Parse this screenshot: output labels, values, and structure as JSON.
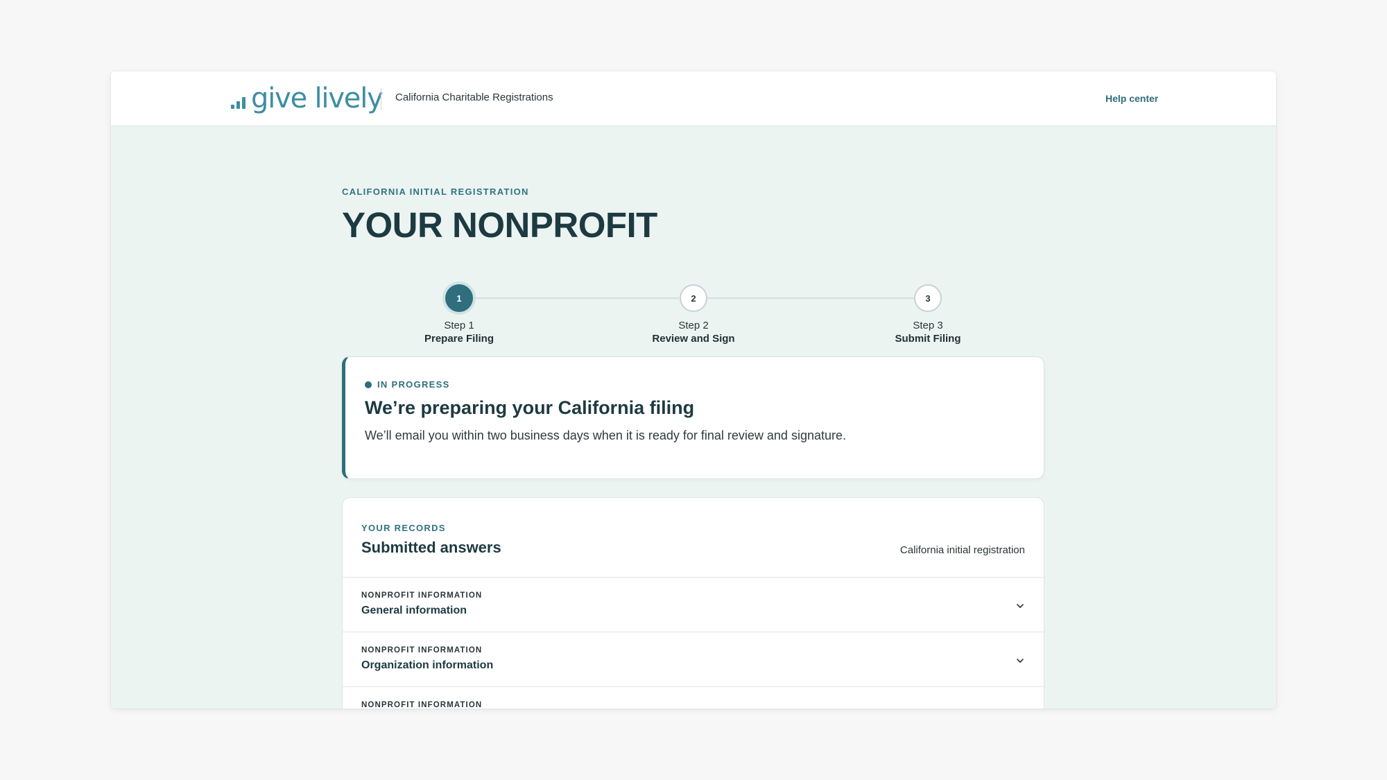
{
  "header": {
    "logo_text": "give lively",
    "app_title": "California Charitable Registrations",
    "help_link": "Help center"
  },
  "page": {
    "eyebrow": "CALIFORNIA INITIAL REGISTRATION",
    "title": "YOUR NONPROFIT"
  },
  "stepper": {
    "steps": [
      {
        "number": "1",
        "label": "Step 1",
        "name": "Prepare Filing",
        "state": "active"
      },
      {
        "number": "2",
        "label": "Step 2",
        "name": "Review and Sign",
        "state": "upcoming"
      },
      {
        "number": "3",
        "label": "Step 3",
        "name": "Submit Filing",
        "state": "upcoming"
      }
    ]
  },
  "status_card": {
    "status": "IN PROGRESS",
    "heading": "We’re preparing your California filing",
    "body": "We’ll email you within two business days when it is ready for final review and signature."
  },
  "records": {
    "eyebrow": "YOUR RECORDS",
    "heading": "Submitted answers",
    "meta": "California initial registration",
    "items": [
      {
        "kicker": "NONPROFIT INFORMATION",
        "title": "General information"
      },
      {
        "kicker": "NONPROFIT INFORMATION",
        "title": "Organization information"
      },
      {
        "kicker": "NONPROFIT INFORMATION",
        "title": ""
      }
    ]
  },
  "colors": {
    "brand": "#3d8ea3",
    "accent": "#2f6e7d",
    "background": "#ecf4f1"
  }
}
